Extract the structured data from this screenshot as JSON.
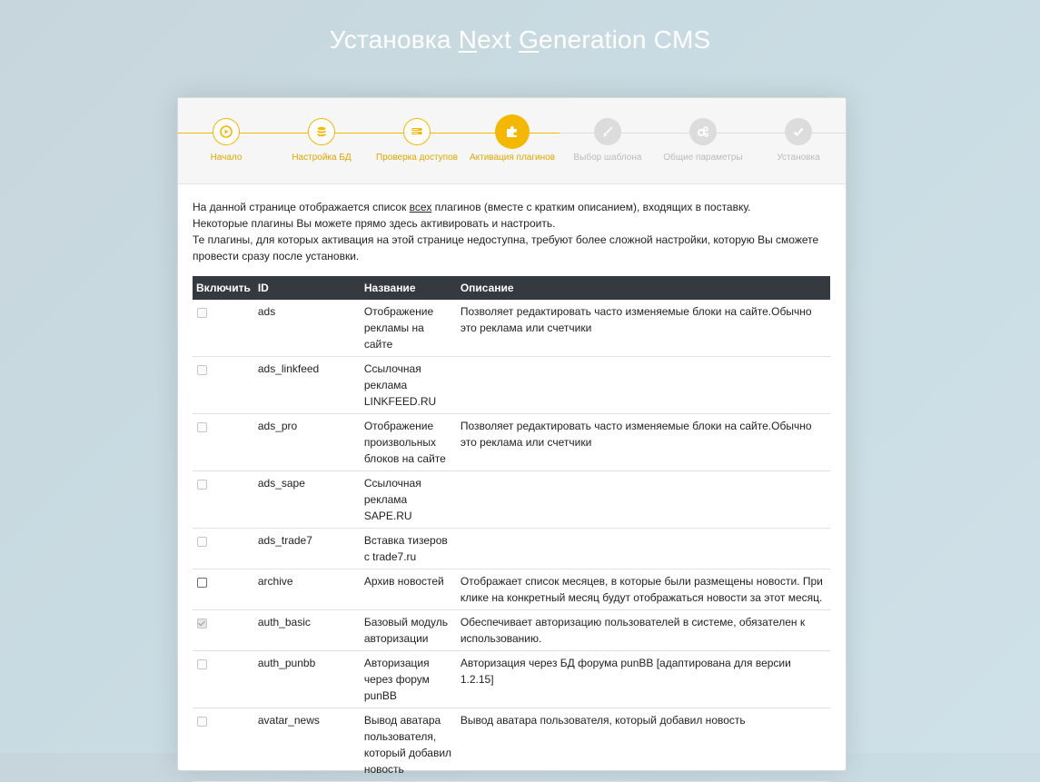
{
  "header": {
    "title_prefix": "Установка ",
    "title_n": "N",
    "title_ext": "ext ",
    "title_g": "G",
    "title_rest": "eneration CMS"
  },
  "colors": {
    "accent": "#f5b800",
    "table_header": "#343a40",
    "inactive": "#dcdcdc"
  },
  "steps": [
    {
      "label": "Начало",
      "icon": "play-icon",
      "state": "done"
    },
    {
      "label": "Настройка БД",
      "icon": "database-icon",
      "state": "done"
    },
    {
      "label": "Проверка доступов",
      "icon": "server-icon",
      "state": "done"
    },
    {
      "label": "Активация плагинов",
      "icon": "puzzle-icon",
      "state": "current"
    },
    {
      "label": "Выбор шаблона",
      "icon": "brush-icon",
      "state": "todo"
    },
    {
      "label": "Общие параметры",
      "icon": "gears-icon",
      "state": "todo"
    },
    {
      "label": "Установка",
      "icon": "check-icon",
      "state": "todo"
    }
  ],
  "intro": {
    "line1_a": "На данной странице отображается список ",
    "line1_u": "всех",
    "line1_b": " плагинов (вместе с кратким описанием), входящих в поставку.",
    "line2": "Некоторые плагины Вы можете прямо здесь активировать и настроить.",
    "line3": "Те плагины, для которых активация на этой странице недоступна, требуют более сложной настройки, которую Вы сможете провести сразу после установки."
  },
  "table": {
    "headers": {
      "enable": "Включить",
      "id": "ID",
      "name": "Название",
      "desc": "Описание"
    },
    "rows": [
      {
        "id": "ads",
        "name": "Отображение рекламы на сайте",
        "desc": "Позволяет редактировать часто изменяемые блоки на сайте.Обычно это реклама или счетчики",
        "checkbox": "disabled"
      },
      {
        "id": "ads_linkfeed",
        "name": "Ссылочная реклама LINKFEED.RU",
        "desc": "",
        "checkbox": "disabled"
      },
      {
        "id": "ads_pro",
        "name": "Отображение произвольных блоков на сайте",
        "desc": "Позволяет редактировать часто изменяемые блоки на сайте.Обычно это реклама или счетчики",
        "checkbox": "disabled"
      },
      {
        "id": "ads_sape",
        "name": "Ссылочная реклама SAPE.RU",
        "desc": "",
        "checkbox": "disabled"
      },
      {
        "id": "ads_trade7",
        "name": "Вставка тизеров с trade7.ru",
        "desc": "",
        "checkbox": "disabled"
      },
      {
        "id": "archive",
        "name": "Архив новостей",
        "desc": "Отображает список месяцев, в которые были размещены новости. При клике на конкретный месяц будут отображаться новости за этот месяц.",
        "checkbox": "active"
      },
      {
        "id": "auth_basic",
        "name": "Базовый модуль авторизации",
        "desc": "Обеспечивает авторизацию пользователей в системе, обязателен к использованию.",
        "checkbox": "checked"
      },
      {
        "id": "auth_punbb",
        "name": "Авторизация через форум punBB",
        "desc": "Авторизация через БД форума punBB [адаптирована для версии 1.2.15]",
        "checkbox": "disabled"
      },
      {
        "id": "avatar_news",
        "name": "Вывод аватара пользователя, который добавил новость",
        "desc": "Вывод аватара пользователя, который добавил новость",
        "checkbox": "disabled"
      }
    ]
  }
}
